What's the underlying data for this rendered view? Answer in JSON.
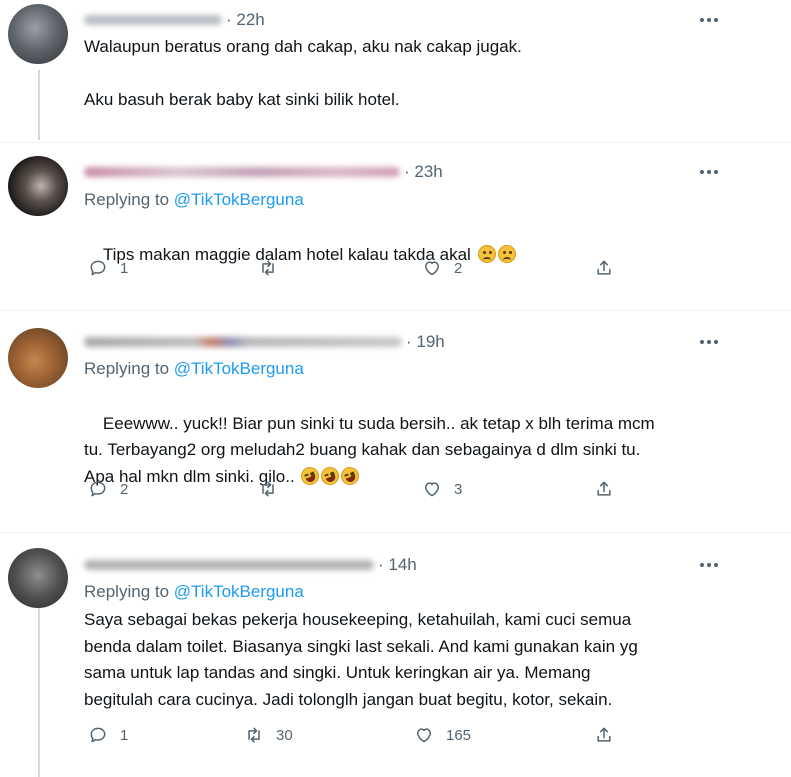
{
  "tweets": [
    {
      "time": "· 22h",
      "text": "Walaupun beratus orang dah cakap, aku nak cakap jugak.\n\nAku basuh berak baby kat sinki bilik hotel.",
      "avatar_icon": "avatar-image-icon",
      "name_blur_color": "#9aa3ab"
    },
    {
      "time": "· 23h",
      "replying_prefix": "Replying to ",
      "replying_handle": "@TikTokBerguna",
      "text": "Tips makan maggie dalam hotel kalau takda akal",
      "emojis": [
        "slightly-frowning-face",
        "slightly-frowning-face"
      ],
      "reply_count": "1",
      "retweet_count": "",
      "like_count": "2",
      "name_blur_color": "#c98aa6"
    },
    {
      "time": "· 19h",
      "replying_prefix": "Replying to ",
      "replying_handle": "@TikTokBerguna",
      "text": "Eeewww.. yuck!! Biar pun sinki tu suda bersih.. ak tetap x blh terima mcm\ntu. Terbayang2 org meludah2 buang kahak dan sebagainya d dlm sinki tu.\nApa hal mkn dlm sinki. gilo..",
      "emojis": [
        "rolling-on-floor-laughing",
        "rolling-on-floor-laughing",
        "rolling-on-floor-laughing"
      ],
      "reply_count": "2",
      "retweet_count": "",
      "like_count": "3",
      "name_blur_color": "#a9a9a9"
    },
    {
      "time": "· 14h",
      "replying_prefix": "Replying to ",
      "replying_handle": "@TikTokBerguna",
      "text": "Saya sebagai bekas pekerja housekeeping, ketahuilah, kami cuci semua\nbenda dalam toilet. Biasanya singki last sekali. And kami gunakan kain yg\nsama untuk lap tandas and singki. Untuk keringkan air ya. Memang\nbegitulah cara cucinya. Jadi tolonglh jangan buat begitu, kotor, sekain.",
      "reply_count": "1",
      "retweet_count": "30",
      "like_count": "165",
      "name_blur_color": "#a9a9a9"
    }
  ],
  "colors": {
    "text": "#0f1419",
    "secondary": "#536471",
    "link": "#1d9bf0",
    "divider": "#eff3f4",
    "thread_line": "#cfd9de"
  },
  "icons": {
    "more": "more-options-icon",
    "reply": "reply-bubble-icon",
    "retweet": "retweet-icon",
    "like": "heart-icon",
    "share": "share-icon"
  }
}
